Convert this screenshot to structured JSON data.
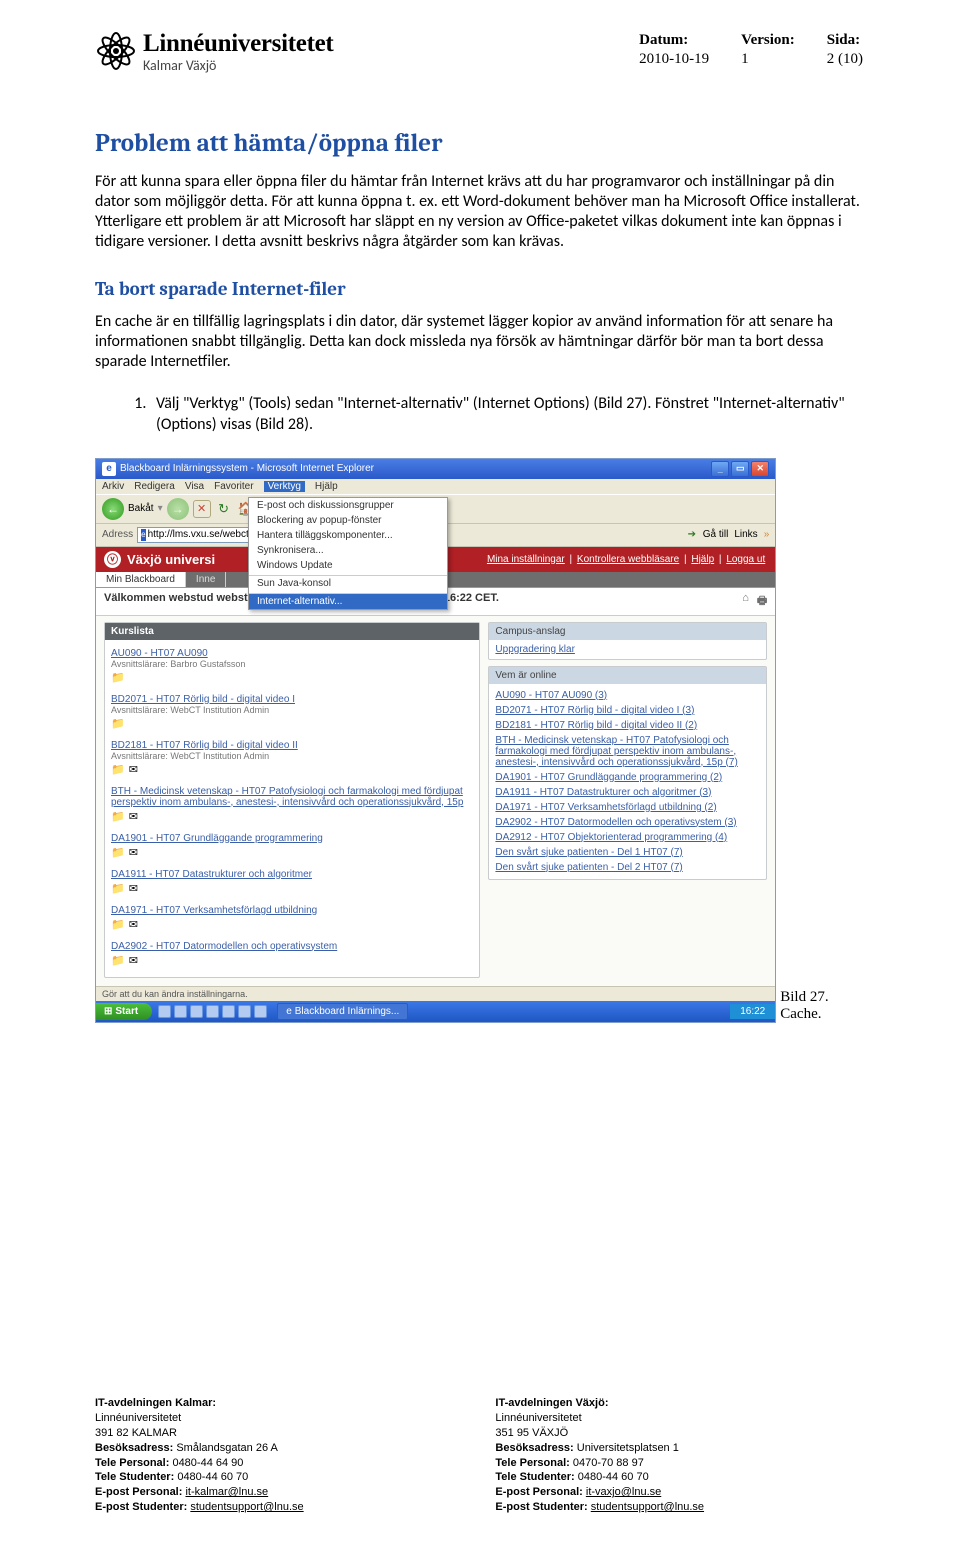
{
  "header": {
    "logo_title": "Linnéuniversitetet",
    "logo_sub": "Kalmar Växjö",
    "meta": {
      "datum_lbl": "Datum:",
      "datum_val": "2010-10-19",
      "version_lbl": "Version:",
      "version_val": "1",
      "sida_lbl": "Sida:",
      "sida_val": "2 (10)"
    }
  },
  "h1": "Problem att hämta/öppna filer",
  "p1": "För att kunna spara eller öppna filer du hämtar från Internet krävs att du har programvaror och inställningar på din dator som möjliggör detta. För att kunna öppna t. ex. ett Word-dokument behöver man ha Microsoft Office installerat. Ytterligare ett problem är att Microsoft har släppt en ny version av Office-paketet vilkas dokument inte kan öppnas i tidigare versioner. I detta avsnitt beskrivs några åtgärder som kan krävas.",
  "h2": "Ta bort sparade Internet-filer",
  "p2": "En cache är en tillfällig lagringsplats i din dator, där systemet lägger kopior av använd information för att senare ha informationen snabbt tillgänglig. Detta kan dock missleda nya försök av hämtningar därför bör man ta bort dessa sparade Internetfiler.",
  "step1": "Välj \"Verktyg\" (Tools) sedan \"Internet-alternativ\" (Internet Options) (Bild 27). Fönstret \"Internet-alternativ\" (Options) visas (Bild 28).",
  "caption": "Bild 27. Cache.",
  "bb": {
    "title": "Blackboard Inlärningssystem - Microsoft Internet Explorer",
    "menu": {
      "arkiv": "Arkiv",
      "redigera": "Redigera",
      "visa": "Visa",
      "favoriter": "Favoriter",
      "verktyg": "Verktyg",
      "hjalp": "Hjälp"
    },
    "tb": {
      "back": "Bakåt"
    },
    "dd": {
      "i1": "E-post och diskussionsgrupper",
      "i2": "Blockering av popup-fönster",
      "i3": "Hantera tilläggskomponenter...",
      "i4": "Synkronisera...",
      "i5": "Windows Update",
      "i6": "Sun Java-konsol",
      "i7": "Internet-alternativ..."
    },
    "addr": {
      "lbl": "Adress",
      "val": "http://lms.vxu.se/webct/",
      "ga": "Gå till",
      "links": "Links"
    },
    "vaxjo": {
      "title": "Växjö universi",
      "r1": "Mina inställningar",
      "r2": "Kontrollera webbläsare",
      "r3": "Hjälp",
      "r4": "Logga ut"
    },
    "tabs": {
      "t1": "Min Blackboard",
      "t2": "Inne"
    },
    "welcome": "Välkommen webstud webstud. I dag är det den 1 november 2007 16:22 CET.",
    "panels": {
      "kurslista": "Kurslista",
      "campus_hd": "Campus-anslag",
      "campus_bd": "Uppgradering klar",
      "vem_hd": "Vem är online"
    },
    "courses": [
      {
        "t": "AU090 - HT07 AU090",
        "s": "Avsnittslärare: Barbro Gustafsson"
      },
      {
        "t": "BD2071 - HT07 Rörlig bild - digital video I",
        "s": "Avsnittslärare: WebCT Institution Admin"
      },
      {
        "t": "BD2181 - HT07 Rörlig bild - digital video II",
        "s": "Avsnittslärare: WebCT Institution Admin"
      },
      {
        "t": "BTH - Medicinsk vetenskap - HT07 Patofysiologi och farmakologi med fördjupat perspektiv inom ambulans-, anestesi-, intensivvård och operationssjukvård, 15p",
        "s": ""
      },
      {
        "t": "DA1901 - HT07 Grundläggande programmering",
        "s": ""
      },
      {
        "t": "DA1911 - HT07 Datastrukturer och algoritmer",
        "s": ""
      },
      {
        "t": "DA1971 - HT07 Verksamhetsförlagd utbildning",
        "s": ""
      },
      {
        "t": "DA2902 - HT07 Datormodellen och operativsystem",
        "s": ""
      }
    ],
    "online": [
      "AU090 - HT07 AU090 (3)",
      "BD2071 - HT07 Rörlig bild - digital video I (3)",
      "BD2181 - HT07 Rörlig bild - digital video II (2)",
      "BTH - Medicinsk vetenskap - HT07 Patofysiologi och farmakologi med fördjupat perspektiv inom ambulans-, anestesi-, intensivvård och operationssjukvård, 15p (7)",
      "DA1901 - HT07 Grundläggande programmering (2)",
      "DA1911 - HT07 Datastrukturer och algoritmer (3)",
      "DA1971 - HT07 Verksamhetsförlagd utbildning (2)",
      "DA2902 - HT07 Datormodellen och operativsystem (3)",
      "DA2912 - HT07 Objektorienterad programmering (4)",
      "Den svårt sjuke patienten - Del 1 HT07 (7)",
      "Den svårt sjuke patienten - Del 2 HT07 (7)"
    ],
    "status": "Gör att du kan ändra inställningarna.",
    "task": {
      "start": "Start",
      "app": "Blackboard Inlärnings...",
      "clock": "16:22"
    }
  },
  "footer": {
    "left": {
      "title": "IT-avdelningen Kalmar:",
      "l1": "Linnéuniversitetet",
      "l2": "391 82 KALMAR",
      "l3a": "Besöksadress:",
      "l3b": " Smålandsgatan 26 A",
      "l4a": "Tele Personal:",
      "l4b": " 0480-44 64 90",
      "l5a": "Tele Studenter:",
      "l5b": " 0480-44 60 70",
      "l6a": "E-post Personal:",
      "l6b": "it-kalmar@lnu.se",
      "l7a": "E-post Studenter:",
      "l7b": "studentsupport@lnu.se"
    },
    "right": {
      "title": "IT-avdelningen Växjö:",
      "l1": "Linnéuniversitetet",
      "l2": "351 95 VÄXJÖ",
      "l3a": "Besöksadress:",
      "l3b": " Universitetsplatsen 1",
      "l4a": "Tele Personal:",
      "l4b": " 0470-70 88 97",
      "l5a": "Tele Studenter:",
      "l5b": " 0480-44 60 70",
      "l6a": "E-post Personal:",
      "l6b": "it-vaxjo@lnu.se",
      "l7a": "E-post Studenter:",
      "l7b": "studentsupport@lnu.se"
    }
  }
}
